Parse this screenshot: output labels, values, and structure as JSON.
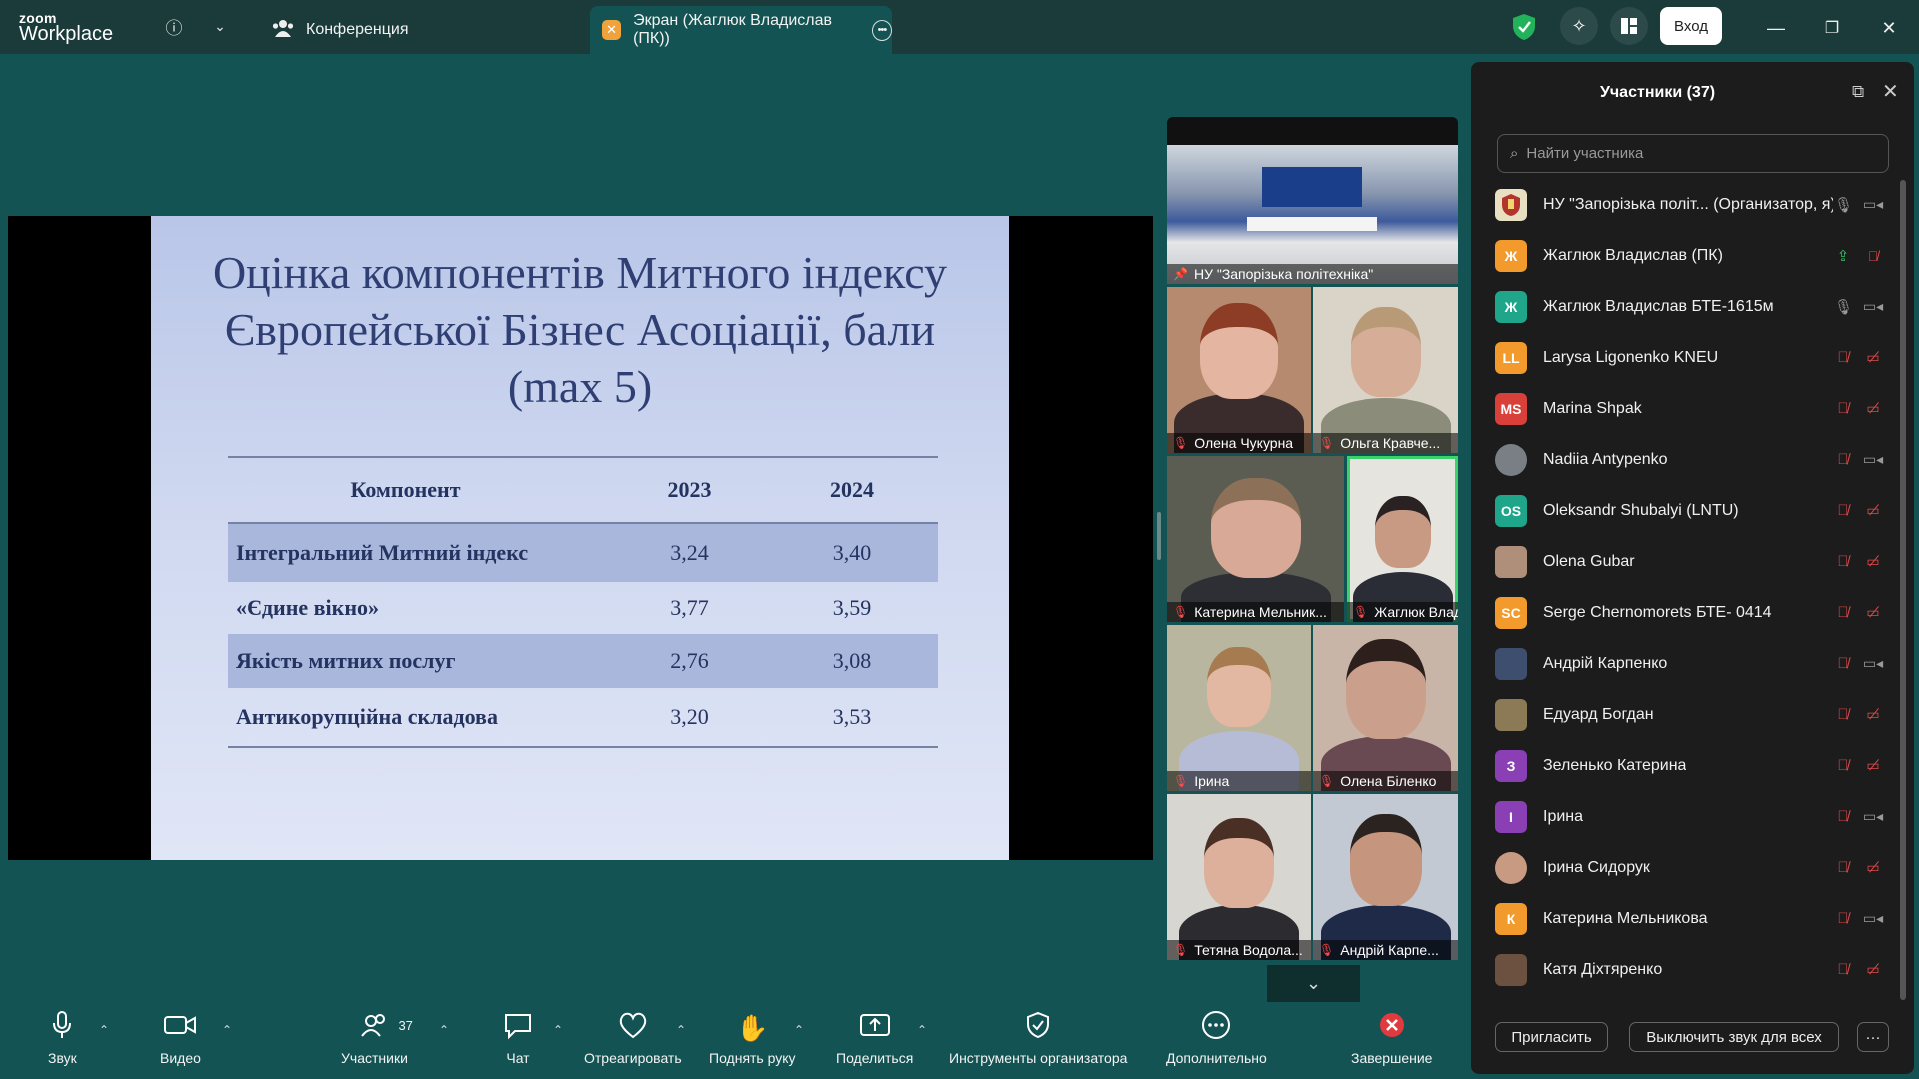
{
  "app": {
    "logo_top": "zoom",
    "logo_bottom": "Workplace"
  },
  "tabs": {
    "conference": "Конференция",
    "screen": "Экран (Жаглюк Владислав (ПК))"
  },
  "topbar": {
    "login": "Вход"
  },
  "slide": {
    "title_line1": "Оцінка компонентів Митного індексу",
    "title_line2": "Європейської Бізнес Асоціації, бали",
    "title_line3": "(max 5)",
    "headers": [
      "Компонент",
      "2023",
      "2024"
    ],
    "rows": [
      {
        "component": "Інтегральний Митний індекс",
        "y2023": "3,24",
        "y2024": "3,40"
      },
      {
        "component": "«Єдине вікно»",
        "y2023": "3,77",
        "y2024": "3,59"
      },
      {
        "component": "Якість митних послуг",
        "y2023": "2,76",
        "y2024": "3,08"
      },
      {
        "component": "Антикорупційна складова",
        "y2023": "3,20",
        "y2024": "3,53"
      }
    ]
  },
  "gallery": [
    {
      "name": "НУ \"Запорізька політехніка\""
    },
    {
      "name": "Олена Чукурна"
    },
    {
      "name": "Ольга Кравче..."
    },
    {
      "name": "Катерина Мельник..."
    },
    {
      "name": "Жаглюк Влад..."
    },
    {
      "name": "Ірина"
    },
    {
      "name": "Олена Біленко"
    },
    {
      "name": "Тетяна Водола..."
    },
    {
      "name": "Андрій Карпе..."
    }
  ],
  "panel": {
    "title": "Участники (37)",
    "search_placeholder": "Найти участника",
    "participants": [
      {
        "initials": "",
        "color": "#d8cfa8",
        "name": "НУ \"Запорізька політ... (Организатор, я)"
      },
      {
        "initials": "Ж",
        "color": "#f29a2b",
        "name": "Жаглюк Владислав (ПК)"
      },
      {
        "initials": "Ж",
        "color": "#1ea58a",
        "name": "Жаглюк Владислав БТЕ-1615м"
      },
      {
        "initials": "LL",
        "color": "#f29a2b",
        "name": "Larysa Ligonenko KNEU"
      },
      {
        "initials": "MS",
        "color": "#d9403a",
        "name": "Marina Shpak"
      },
      {
        "initials": "",
        "color": "#7a7f86",
        "name": "Nadiia Antypenko"
      },
      {
        "initials": "OS",
        "color": "#1ea58a",
        "name": "Oleksandr Shubalyi (LNTU)"
      },
      {
        "initials": "",
        "color": "#b08f7a",
        "name": "Olena Gubar"
      },
      {
        "initials": "SC",
        "color": "#f29a2b",
        "name": "Serge Chernomorets БТЕ- 0414"
      },
      {
        "initials": "",
        "color": "#3e4e6e",
        "name": "Андрій Карпенко"
      },
      {
        "initials": "",
        "color": "#8b7a55",
        "name": "Едуард Богдан"
      },
      {
        "initials": "З",
        "color": "#8a3fb5",
        "name": "Зеленько Катерина"
      },
      {
        "initials": "І",
        "color": "#8a3fb5",
        "name": "Ірина"
      },
      {
        "initials": "",
        "color": "#c99a82",
        "name": "Ірина Сидорук"
      },
      {
        "initials": "К",
        "color": "#f29a2b",
        "name": "Катерина Мельникова"
      },
      {
        "initials": "",
        "color": "#6c5040",
        "name": "Катя Діхтяренко"
      }
    ],
    "invite": "Пригласить",
    "mute_all": "Выключить звук для всех",
    "more": "···"
  },
  "toolbar": {
    "audio": "Звук",
    "video": "Видео",
    "participants": "Участники",
    "participants_count": "37",
    "chat": "Чат",
    "react": "Отреагировать",
    "raise_hand": "Поднять руку",
    "share": "Поделиться",
    "host_tools": "Инструменты организатора",
    "more": "Дополнительно",
    "end": "Завершение"
  }
}
